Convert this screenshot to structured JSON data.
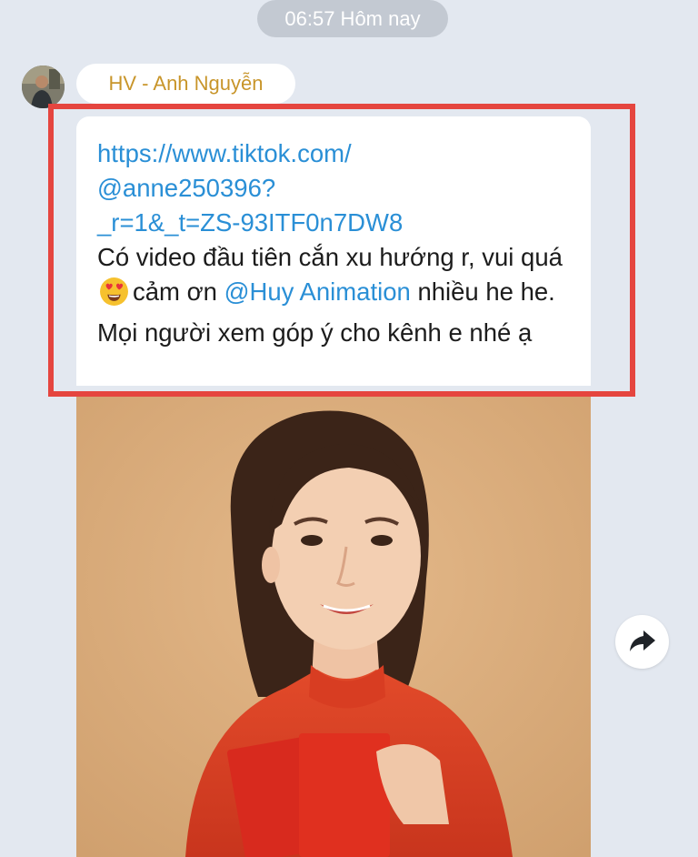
{
  "chat": {
    "timestamp": "06:57 Hôm nay",
    "sender_name": "HV - Anh Nguyễn"
  },
  "message": {
    "link_line_1": "https://www.tiktok.com/",
    "link_line_2": "@anne250396?",
    "link_line_3": "_r=1&_t=ZS-93ITF0n7DW8",
    "text_before_emoji": "Có video đầu tiên cắn xu hướng r, vui quá",
    "emoji": "heart-eyes-emoji",
    "text_after_emoji": "cảm ơn",
    "mention": "@Huy Animation",
    "text_after_mention": "nhiều he he. Mọi người xem góp ý cho kênh e nhé ạ"
  },
  "colors": {
    "background": "#e3e8f0",
    "link": "#2a8fd6",
    "sender_name": "#c8952a",
    "highlight": "#e5453f"
  },
  "icons": {
    "forward": "share-arrow-icon"
  }
}
